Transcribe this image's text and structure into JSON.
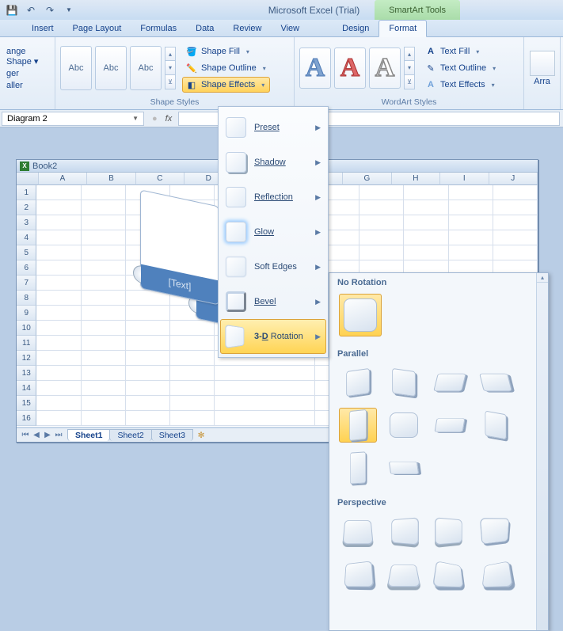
{
  "app": {
    "title": "Microsoft Excel (Trial)",
    "context_group": "SmartArt Tools"
  },
  "tabs": {
    "insert": "Insert",
    "page_layout": "Page Layout",
    "formulas": "Formulas",
    "data": "Data",
    "review": "Review",
    "view": "View",
    "design": "Design",
    "format": "Format"
  },
  "ribbon": {
    "shapes_group": {
      "change_shape": "ange Shape ▾",
      "larger": "ger",
      "smaller": "aller",
      "abc": "Abc",
      "label": "Shape Styles",
      "shape_fill": "Shape Fill",
      "shape_outline": "Shape Outline",
      "shape_effects": "Shape Effects"
    },
    "wordart_group": {
      "label": "WordArt Styles",
      "text_fill": "Text Fill",
      "text_outline": "Text Outline",
      "text_effects": "Text Effects"
    },
    "arrange_group": {
      "arrange": "Arra"
    }
  },
  "namebar": {
    "name": "Diagram 2",
    "fx": "fx"
  },
  "book": {
    "title": "Book2",
    "columns": [
      "A",
      "B",
      "C",
      "D",
      "",
      "G",
      "H",
      "I",
      "J"
    ],
    "rows": [
      "1",
      "2",
      "3",
      "4",
      "5",
      "6",
      "7",
      "8",
      "9",
      "10",
      "11",
      "12",
      "13",
      "14",
      "15",
      "16"
    ],
    "smartart_placeholder": "[Text]",
    "sheets": {
      "s1": "Sheet1",
      "s2": "Sheet2",
      "s3": "Sheet3"
    }
  },
  "menu": {
    "preset": "Preset",
    "shadow": "Shadow",
    "reflection": "Reflection",
    "glow": "Glow",
    "soft_edges": "Soft Edges",
    "bevel": "Bevel",
    "rotation": "3-D Rotation"
  },
  "gallery": {
    "no_rotation": "No Rotation",
    "parallel": "Parallel",
    "perspective": "Perspective"
  }
}
